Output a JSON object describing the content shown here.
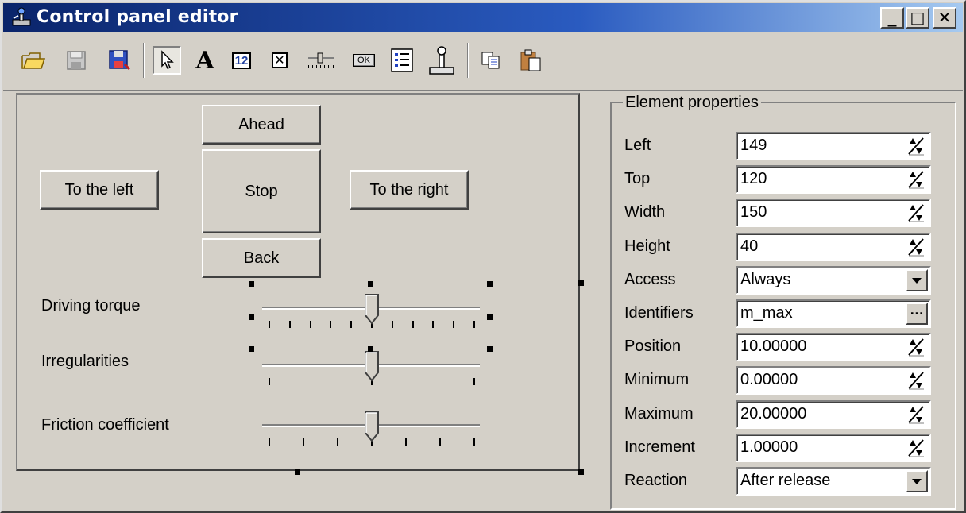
{
  "window": {
    "title": "Control panel editor",
    "controls": {
      "minimize": "_",
      "maximize": "□",
      "close": "✕"
    }
  },
  "toolbar": {
    "icons": [
      "open-folder-icon",
      "save-icon",
      "save-as-icon",
      "pointer-icon",
      "text-icon",
      "numeric-field-icon",
      "checkbox-icon",
      "slider-icon",
      "button-icon",
      "list-icon",
      "joystick-icon",
      "copy-icon",
      "paste-icon"
    ],
    "text_tool_glyph": "A",
    "numeric_tool_glyph": "12",
    "checkbox_tool_glyph": "✕",
    "button_tool_glyph": "OK"
  },
  "panel": {
    "buttons": {
      "ahead": "Ahead",
      "stop": "Stop",
      "back": "Back",
      "left": "To the left",
      "right": "To the right"
    },
    "sliders": [
      {
        "label": "Driving torque",
        "position": 10,
        "min": 0,
        "max": 20,
        "ticks": 11
      },
      {
        "label": "Irregularities",
        "position": 10,
        "min": 0,
        "max": 20,
        "ticks": 3
      },
      {
        "label": "Friction coefficient",
        "position": 10,
        "min": 0,
        "max": 20,
        "ticks": 7
      }
    ]
  },
  "properties": {
    "legend": "Element properties",
    "rows": [
      {
        "label": "Left",
        "value": "149",
        "kind": "spin"
      },
      {
        "label": "Top",
        "value": "120",
        "kind": "spin"
      },
      {
        "label": "Width",
        "value": "150",
        "kind": "spin"
      },
      {
        "label": "Height",
        "value": "40",
        "kind": "spin"
      },
      {
        "label": "Access",
        "value": "Always",
        "kind": "dropdown"
      },
      {
        "label": "Identifiers",
        "value": "m_max",
        "kind": "ellipsis",
        "button": "…"
      },
      {
        "label": "Position",
        "value": "10.00000",
        "kind": "spin"
      },
      {
        "label": "Minimum",
        "value": "0.00000",
        "kind": "spin"
      },
      {
        "label": "Maximum",
        "value": "20.00000",
        "kind": "spin"
      },
      {
        "label": "Increment",
        "value": "1.00000",
        "kind": "spin"
      },
      {
        "label": "Reaction",
        "value": "After release",
        "kind": "dropdown"
      }
    ]
  },
  "colors": {
    "face": "#d4d0c8",
    "title_start": "#0a246a",
    "title_end": "#a6caf0"
  }
}
